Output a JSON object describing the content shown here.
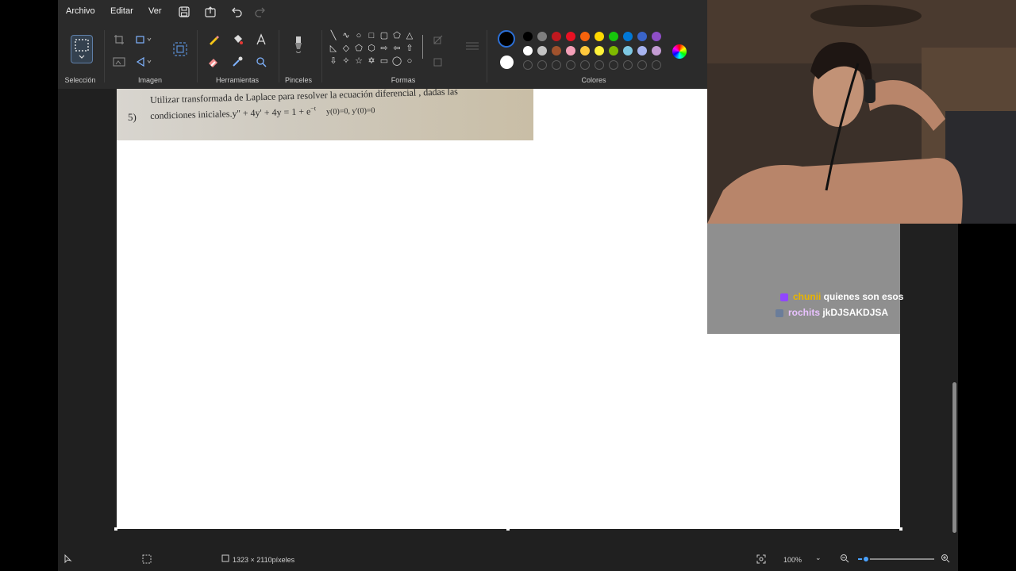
{
  "menu": {
    "file": "Archivo",
    "edit": "Editar",
    "view": "Ver"
  },
  "ribbon": {
    "selection": "Selección",
    "image": "Imagen",
    "tools": "Herramientas",
    "brushes": "Pinceles",
    "shapes": "Formas",
    "colors": "Colores"
  },
  "palette": {
    "row1": [
      "#000000",
      "#7f7f7f",
      "#c0181f",
      "#e81123",
      "#f7630c",
      "#ffd800",
      "#16c60c",
      "#0078d7",
      "#3a64c8",
      "#8e4ec6"
    ],
    "row2": [
      "#ffffff",
      "#c3c3c3",
      "#a0522d",
      "#f4a0b8",
      "#ffc83d",
      "#fff23b",
      "#7fba00",
      "#7ec8e3",
      "#a7b4f0",
      "#c39bd3"
    ]
  },
  "canvas": {
    "problem_number": "5)",
    "problem_line1": "Utilizar transformada de Laplace para resolver la ecuación diferencial , dadas las",
    "problem_line2": "condiciones iniciales.y'' + 4y' + 4y = 1 + e",
    "problem_exponent": "−t",
    "problem_conditions": "y(0)=0, y'(0)=0"
  },
  "status": {
    "dimensions": "1323 × 2110píxeles",
    "zoom": "100%",
    "zoom_level_fraction": 0.1
  },
  "chat": [
    {
      "user": "chunii",
      "message": "quienes son esos",
      "user_color": "#e8b400",
      "badge_color": "#9147ff"
    },
    {
      "user": "rochits",
      "message": "jkDJSAKDJSA",
      "user_color": "#e9c2ff",
      "badge_color": "#6b7d9a"
    }
  ]
}
